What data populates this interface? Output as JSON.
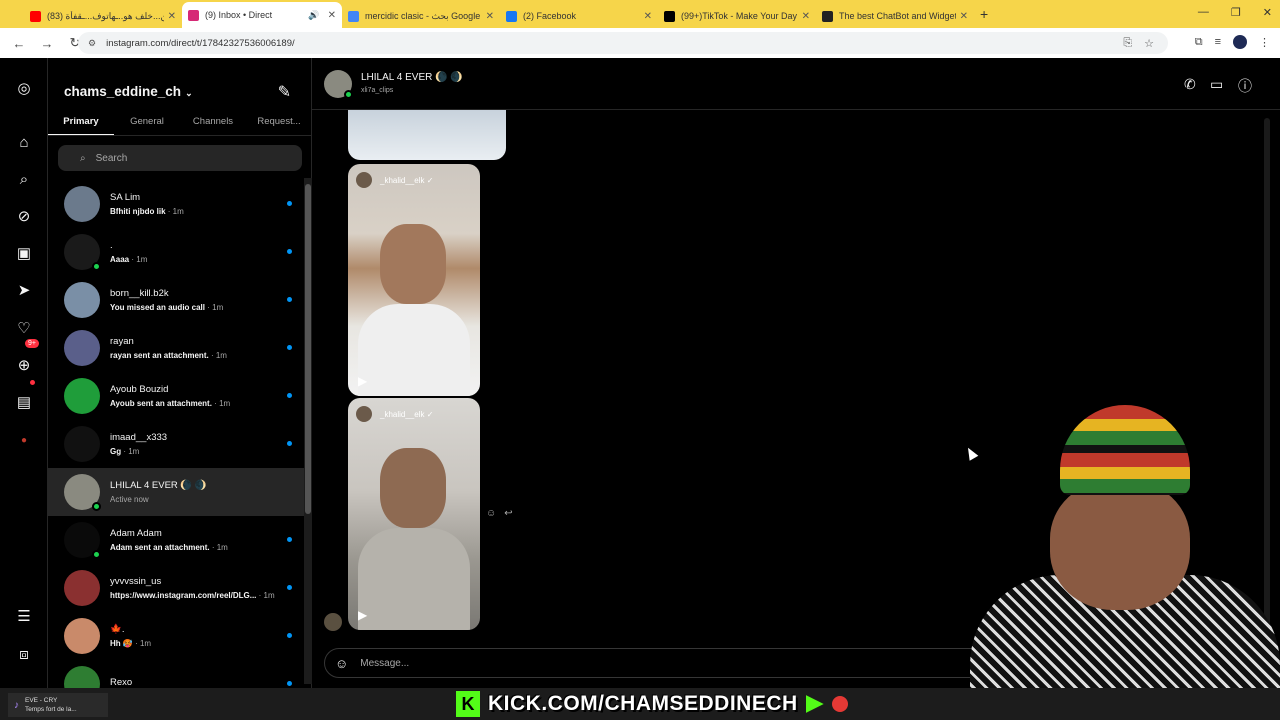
{
  "browser": {
    "tabs": [
      {
        "title": "ين...خلف هو..ـهاتوف...ـقفأة (83)",
        "color": "#ff0000"
      },
      {
        "title": "(9) Inbox • Direct",
        "color": "#d62976",
        "active": true
      },
      {
        "title": "mercidic clasic - بحث Google",
        "color": "#4285f4"
      },
      {
        "title": "(2) Facebook",
        "color": "#1877f2"
      },
      {
        "title": "(99+)TikTok - Make Your Day",
        "color": "#000000"
      },
      {
        "title": "The best ChatBot and Widgets",
        "color": "#222222"
      }
    ],
    "url": "instagram.com/direct/t/17842327536006189/"
  },
  "inbox": {
    "username": "chams_eddine_ch",
    "tabs": [
      "Primary",
      "General",
      "Channels",
      "Request..."
    ],
    "search_placeholder": "Search",
    "threads": [
      {
        "name": "SA Lim",
        "preview": "Bfhiti njbdo lik",
        "time": "· 1m",
        "avatar": "#6b7a8c",
        "online": false,
        "unread": true
      },
      {
        "name": ".",
        "preview": "Aaaa",
        "time": "· 1m",
        "avatar": "#1a1a1a",
        "online": true,
        "unread": true
      },
      {
        "name": "born__kill.b2k",
        "preview": "You missed an audio call",
        "time": "· 1m",
        "avatar": "#7a8fa6",
        "online": false,
        "unread": true
      },
      {
        "name": "rayan",
        "preview": "rayan sent an attachment.",
        "time": "· 1m",
        "avatar": "#5a5f8a",
        "online": false,
        "unread": true
      },
      {
        "name": "Ayoub Bouzid",
        "preview": "Ayoub sent an attachment.",
        "time": "· 1m",
        "avatar": "#1f9d3a",
        "online": false,
        "unread": true
      },
      {
        "name": "imaad__x333",
        "preview": "Gg",
        "time": "· 1m",
        "avatar": "#111111",
        "online": false,
        "unread": true
      },
      {
        "name": "LHILAL 4 EVER 🌘 🌒",
        "preview": "Active now",
        "time": "",
        "avatar": "#8a8a80",
        "online": true,
        "unread": false,
        "active": true
      },
      {
        "name": "Adam Adam",
        "preview": "Adam sent an attachment.",
        "time": "· 1m",
        "avatar": "#0a0a0a",
        "online": true,
        "unread": true
      },
      {
        "name": "yvvvssin_us",
        "preview": "https://www.instagram.com/reel/DLG...",
        "time": "· 1m",
        "avatar": "#8a3030",
        "online": false,
        "unread": true
      },
      {
        "name": "🍁.",
        "preview": "Hh 🥵",
        "time": "· 1m",
        "avatar": "#c98a6a",
        "online": false,
        "unread": true
      },
      {
        "name": "Rexo",
        "preview": "",
        "time": "",
        "avatar": "#2e7d32",
        "online": false,
        "unread": true
      }
    ]
  },
  "chat": {
    "name": "LHILAL 4 EVER 🌘 🌒",
    "handle": "xli7a_clips",
    "reels": [
      {
        "author": "_khalid__elk"
      },
      {
        "author": "_khalid__elk"
      }
    ],
    "message_placeholder": "Message..."
  },
  "overlay": {
    "now_playing": "EVE - CRY",
    "now_playing_sub": "Temps fort de la...",
    "kick_text": "KICK.COM/CHAMSEDDINECH"
  }
}
